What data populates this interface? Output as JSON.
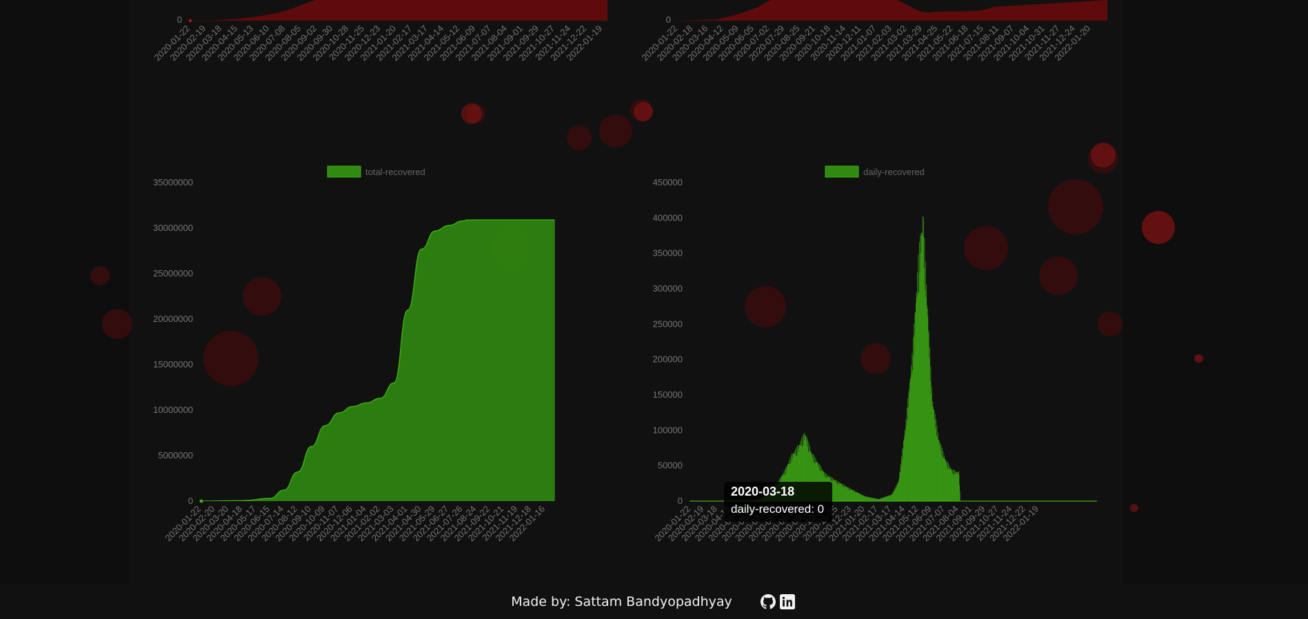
{
  "footer": {
    "credit": "Made by: Sattam Bandyopadhyay",
    "icons": [
      "github-icon",
      "linkedin-icon"
    ]
  },
  "colors": {
    "recovered_fill": "#2f8a0f",
    "recovered_line": "#3fae14",
    "confirmed_fill": "#6d0b0b",
    "background": "#0c0c0c",
    "footer": "#111111"
  },
  "tooltip": {
    "title": "2020-03-18",
    "body": "daily-recovered: 0"
  },
  "top_left_dates": [
    "2020-01-22",
    "2020-02-19",
    "2020-03-18",
    "2020-04-15",
    "2020-05-13",
    "2020-06-10",
    "2020-07-08",
    "2020-08-05",
    "2020-09-02",
    "2020-09-30",
    "2020-10-28",
    "2020-11-25",
    "2020-12-23",
    "2021-01-20",
    "2021-02-17",
    "2021-03-17",
    "2021-04-14",
    "2021-05-12",
    "2021-06-09",
    "2021-07-07",
    "2021-08-04",
    "2021-09-01",
    "2021-09-29",
    "2021-10-27",
    "2021-11-24",
    "2021-12-22",
    "2022-01-19"
  ],
  "top_right_dates": [
    "2020-01-22",
    "2020-02-18",
    "2020-03-16",
    "2020-04-12",
    "2020-05-09",
    "2020-06-05",
    "2020-07-02",
    "2020-07-29",
    "2020-08-25",
    "2020-09-21",
    "2020-10-18",
    "2020-11-14",
    "2020-12-11",
    "2021-01-07",
    "2021-02-03",
    "2021-03-02",
    "2021-03-29",
    "2021-04-25",
    "2021-05-22",
    "2021-06-18",
    "2021-07-15",
    "2021-08-11",
    "2021-09-07",
    "2021-10-04",
    "2021-10-31",
    "2021-11-27",
    "2021-12-24",
    "2022-01-20"
  ],
  "top_zero_label": "0",
  "chart_data": [
    {
      "type": "area",
      "legend": "total-recovered",
      "ylim": [
        0,
        35000000
      ],
      "yticks": [
        0,
        5000000,
        10000000,
        15000000,
        20000000,
        25000000,
        30000000,
        35000000
      ],
      "x_tick_labels": [
        "2020-01-22",
        "2020-02-20",
        "2020-03-20",
        "2020-04-18",
        "2020-05-17",
        "2020-06-15",
        "2020-07-14",
        "2020-08-12",
        "2020-09-10",
        "2020-10-09",
        "2020-11-07",
        "2020-12-06",
        "2021-01-04",
        "2021-02-02",
        "2021-03-03",
        "2021-04-01",
        "2021-04-30",
        "2021-05-29",
        "2021-06-27",
        "2021-07-26",
        "2021-08-24",
        "2021-09-22",
        "2021-10-21",
        "2021-11-19",
        "2021-12-18",
        "2022-01-16"
      ],
      "x": [
        "2020-01-22",
        "2020-04-18",
        "2020-06-15",
        "2020-07-14",
        "2020-08-12",
        "2020-09-10",
        "2020-10-09",
        "2020-11-07",
        "2020-12-06",
        "2021-01-04",
        "2021-02-02",
        "2021-03-03",
        "2021-04-01",
        "2021-04-30",
        "2021-05-29",
        "2021-06-27",
        "2021-07-26",
        "2021-08-05",
        "2021-08-24",
        "2021-09-22",
        "2021-10-21",
        "2021-11-19",
        "2021-12-18",
        "2022-01-16",
        "2022-02-05"
      ],
      "values": [
        0,
        50000,
        300000,
        1200000,
        3200000,
        6000000,
        8300000,
        9700000,
        10400000,
        10800000,
        11300000,
        13000000,
        21000000,
        27700000,
        29700000,
        30300000,
        30800000,
        30900000,
        30900000,
        30900000,
        30900000,
        30900000,
        30900000,
        30900000,
        30900000
      ]
    },
    {
      "type": "bar",
      "legend": "daily-recovered",
      "ylim": [
        0,
        450000
      ],
      "yticks": [
        0,
        50000,
        100000,
        150000,
        200000,
        250000,
        300000,
        350000,
        400000,
        450000
      ],
      "x_tick_labels": [
        "2020-01-22",
        "2020-02-19",
        "2020-03-18",
        "2020-04-15",
        "2020-05-13",
        "2020-06-10",
        "2020-07-08",
        "2020-08-05",
        "2020-09-02",
        "2020-09-30",
        "2020-10-28",
        "2020-11-25",
        "2020-12-23",
        "2021-01-20",
        "2021-02-17",
        "2021-03-17",
        "2021-04-14",
        "2021-05-12",
        "2021-06-09",
        "2021-07-07",
        "2021-08-04",
        "2021-09-01",
        "2021-09-29",
        "2021-10-27",
        "2021-11-24",
        "2021-12-22",
        "2022-01-19"
      ],
      "x": [
        "2020-01-22",
        "2020-02-19",
        "2020-03-18",
        "2020-04-15",
        "2020-05-13",
        "2020-06-10",
        "2020-07-08",
        "2020-08-05",
        "2020-08-20",
        "2020-09-02",
        "2020-09-16",
        "2020-09-30",
        "2020-10-14",
        "2020-10-28",
        "2020-11-25",
        "2020-12-23",
        "2021-01-20",
        "2021-02-17",
        "2021-03-17",
        "2021-03-31",
        "2021-04-14",
        "2021-04-28",
        "2021-05-12",
        "2021-05-21",
        "2021-05-26",
        "2021-06-09",
        "2021-06-23",
        "2021-07-07",
        "2021-07-21",
        "2021-08-04",
        "2021-08-07",
        "2021-09-01",
        "2021-09-29",
        "2021-10-27",
        "2021-11-24",
        "2021-12-22",
        "2022-01-19",
        "2022-02-05"
      ],
      "values": [
        0,
        0,
        0,
        0,
        0,
        2000,
        12000,
        45000,
        68000,
        80000,
        100000,
        70000,
        55000,
        40000,
        28000,
        17000,
        7000,
        3000,
        10000,
        30000,
        110000,
        210000,
        360000,
        420000,
        340000,
        150000,
        90000,
        60000,
        45000,
        42000,
        0,
        0,
        0,
        0,
        0,
        0,
        0,
        0
      ]
    }
  ]
}
